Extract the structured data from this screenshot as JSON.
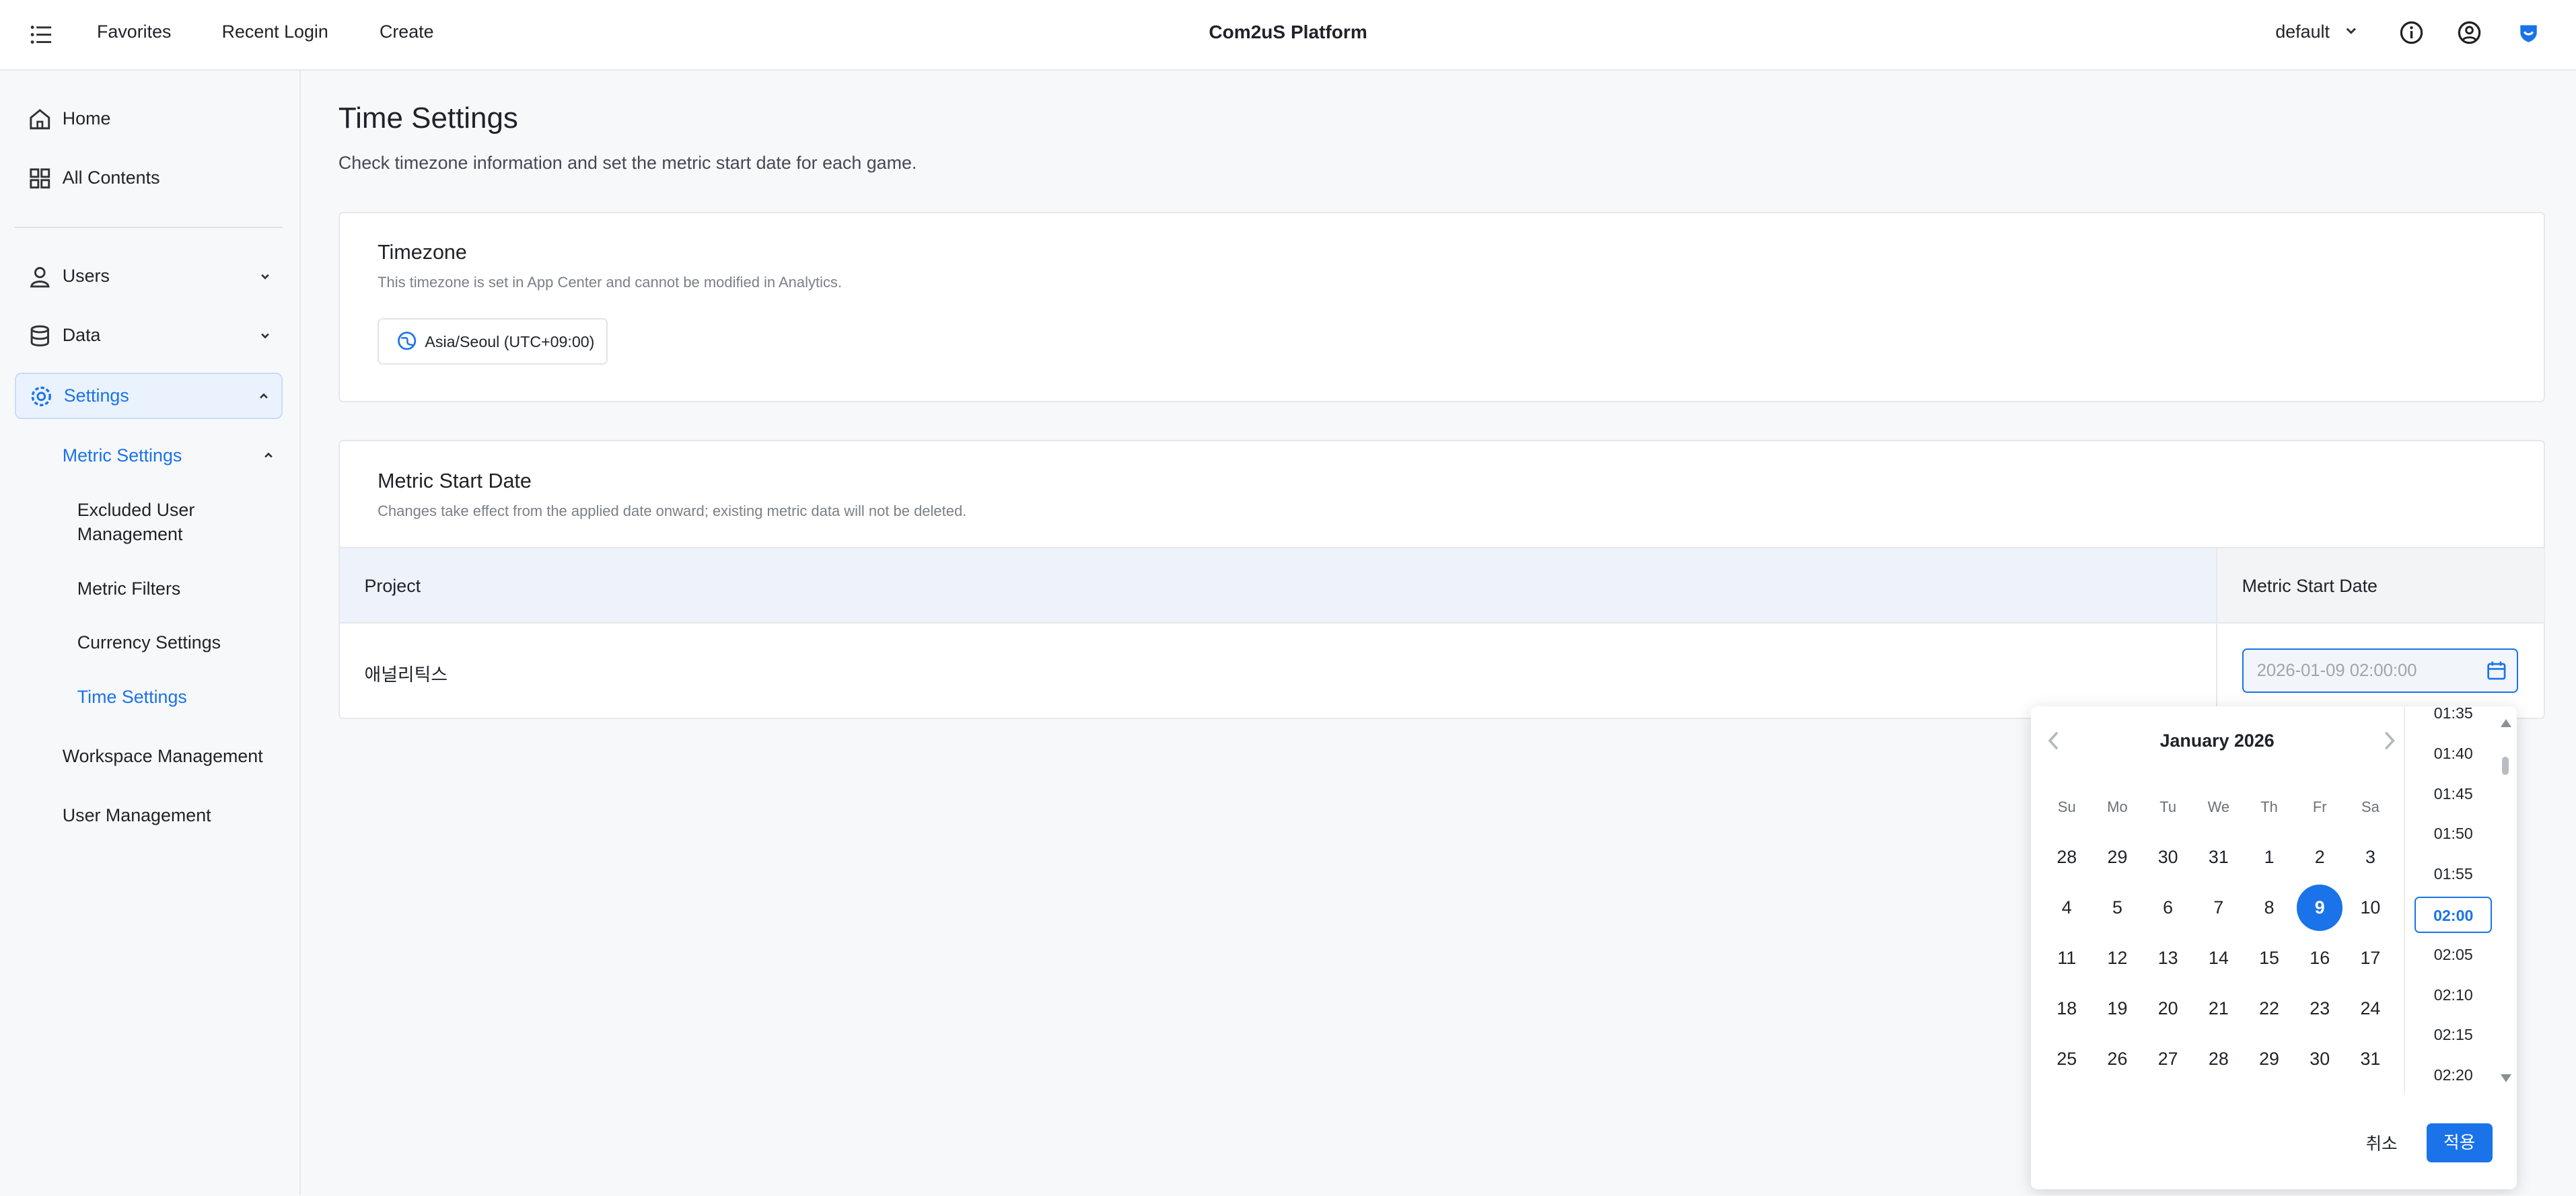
{
  "topbar": {
    "nav": [
      "Favorites",
      "Recent Login",
      "Create"
    ],
    "title": "Com2uS Platform",
    "workspace": "default"
  },
  "sidebar": {
    "home": "Home",
    "all_contents": "All Contents",
    "users": "Users",
    "data": "Data",
    "settings": "Settings",
    "metric_settings": "Metric Settings",
    "excluded_user_line1": "Excluded User",
    "excluded_user_line2": "Management",
    "metric_filters": "Metric Filters",
    "currency_settings": "Currency Settings",
    "time_settings": "Time Settings",
    "workspace_management": "Workspace Management",
    "user_management": "User Management"
  },
  "page": {
    "title": "Time Settings",
    "description": "Check timezone information and set the metric start date for each game."
  },
  "timezone": {
    "title": "Timezone",
    "description": "This timezone is set in App Center and cannot be modified in Analytics.",
    "value": "Asia/Seoul (UTC+09:00)"
  },
  "metric_start": {
    "title": "Metric Start Date",
    "description": "Changes take effect from the applied date onward; existing metric data will not be deleted.",
    "col_project": "Project",
    "col_date": "Metric Start Date",
    "project": "애널리틱스",
    "date_placeholder": "2026-01-09 02:00:00"
  },
  "picker": {
    "month": "January 2026",
    "weekdays": [
      "Su",
      "Mo",
      "Tu",
      "We",
      "Th",
      "Fr",
      "Sa"
    ],
    "weeks": [
      [
        "28",
        "29",
        "30",
        "31",
        "1",
        "2",
        "3"
      ],
      [
        "4",
        "5",
        "6",
        "7",
        "8",
        "9",
        "10"
      ],
      [
        "11",
        "12",
        "13",
        "14",
        "15",
        "16",
        "17"
      ],
      [
        "18",
        "19",
        "20",
        "21",
        "22",
        "23",
        "24"
      ],
      [
        "25",
        "26",
        "27",
        "28",
        "29",
        "30",
        "31"
      ]
    ],
    "selected_day": "9",
    "times": [
      "01:35",
      "01:40",
      "01:45",
      "01:50",
      "01:55",
      "02:00",
      "02:05",
      "02:10",
      "02:15",
      "02:20"
    ],
    "selected_time": "02:00",
    "cancel": "취소",
    "apply": "적용"
  },
  "colors": {
    "accent": "#1a73e8",
    "sidebar_active_bg": "#eaf2fe",
    "table_header_bg": "#eef2fa"
  }
}
